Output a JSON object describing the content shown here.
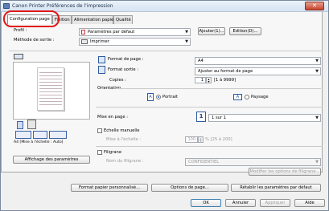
{
  "window": {
    "title": "Canon Printer Préférences de l'impression",
    "close_glyph": "✕"
  },
  "tabs": [
    {
      "label": "Configuration page"
    },
    {
      "label": "Finition"
    },
    {
      "label": "Alimentation papier"
    },
    {
      "label": "Qualité"
    }
  ],
  "profile": {
    "label": "Profil :",
    "value": "Paramètres par défaut",
    "add_button": "Ajouter(1)...",
    "edit_button": "Edition(D)..."
  },
  "output_method": {
    "label": "Méthode de sortie :",
    "value": "Imprimer"
  },
  "preview": {
    "caption": "A4 [Mise à l'échelle : Auto]",
    "settings_button": "Affichage des paramètres"
  },
  "page_format": {
    "label": "Format de page :",
    "value": "A4"
  },
  "output_format": {
    "label": "Format sortie :",
    "value": "Ajuster au format de page"
  },
  "copies": {
    "label": "Copies :",
    "value": "1",
    "range": "[1 à 9999]"
  },
  "orientation": {
    "label": "Orientation",
    "portrait": "Portrait",
    "landscape": "Paysage",
    "portrait_selected": true
  },
  "page_layout": {
    "label": "Mise en page :",
    "value": "1 sur 1",
    "number": "1"
  },
  "manual_scaling": {
    "label": "Echelle manuelle",
    "scale_label": "Mise à l'échelle :",
    "value": "100",
    "range": "% [25 à 200]"
  },
  "watermark": {
    "label": "Filigrane",
    "name_label": "Nom du filigrane :",
    "value": "CONFIDENTIEL",
    "modify_button": "Modifier les options de filigrane..."
  },
  "bottom_buttons": {
    "custom_paper": "Format papier personnalisé...",
    "page_options": "Options de page...",
    "restore_defaults": "Rétablir les paramètres par défaut"
  },
  "dialog_buttons": {
    "ok": "OK",
    "cancel": "Annuler",
    "apply": "Appliquer",
    "help": "Aide"
  }
}
